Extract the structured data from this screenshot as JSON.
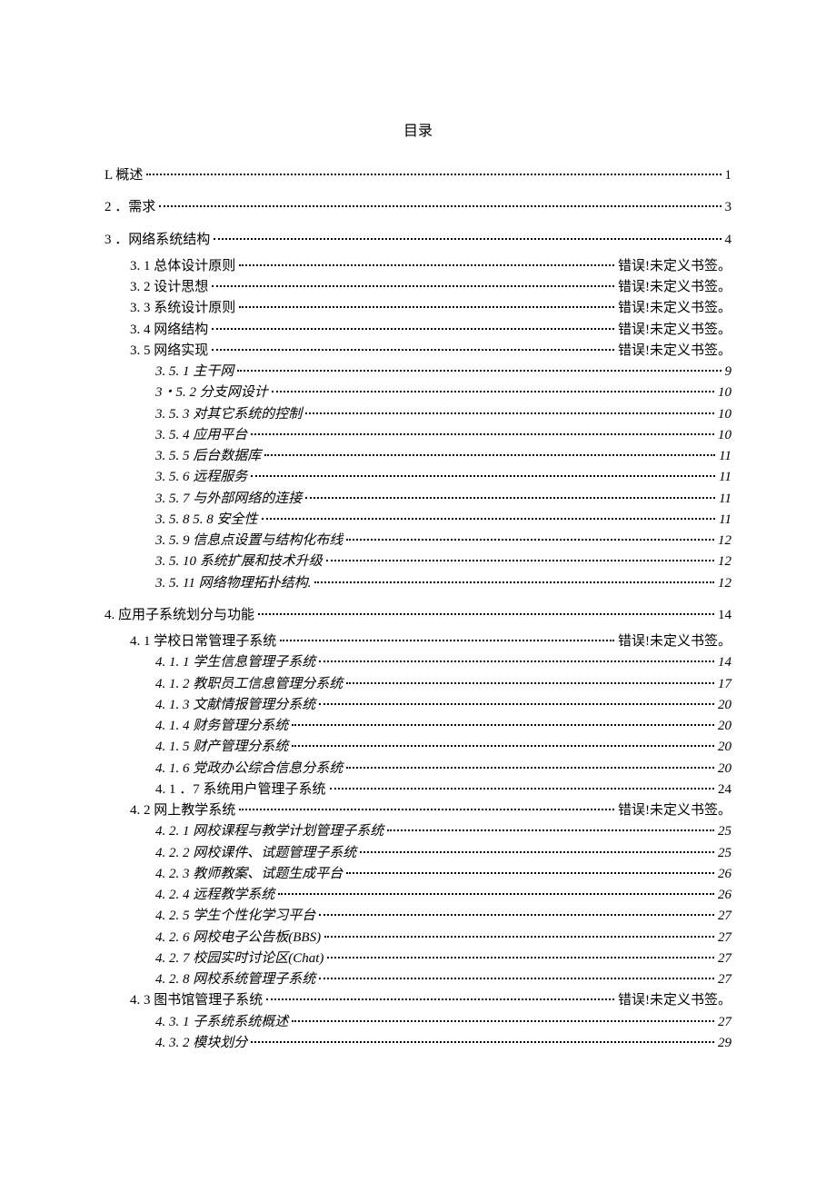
{
  "title": "目录",
  "bookmarkError": "错误!未定义书签。",
  "entries": [
    {
      "level": 1,
      "italic": false,
      "label": "L 概述",
      "page": "1"
    },
    {
      "level": 1,
      "italic": false,
      "label": "2 ．需求",
      "page": "3"
    },
    {
      "level": 1,
      "italic": false,
      "label": "3 ．网络系统结构",
      "page": "4"
    },
    {
      "level": 2,
      "italic": false,
      "label": "3. 1 总体设计原则",
      "page": "错误!未定义书签。"
    },
    {
      "level": 2,
      "italic": false,
      "label": "3. 2 设计思想",
      "page": "错误!未定义书签。"
    },
    {
      "level": 2,
      "italic": false,
      "label": "3. 3 系统设计原则",
      "page": "错误!未定义书签。"
    },
    {
      "level": 2,
      "italic": false,
      "label": "3. 4 网络结构",
      "page": "错误!未定义书签。"
    },
    {
      "level": 2,
      "italic": false,
      "label": "3. 5 网络实现",
      "page": "错误!未定义书签。"
    },
    {
      "level": 3,
      "italic": true,
      "label": "3. 5. 1 主干网",
      "page": "9"
    },
    {
      "level": 3,
      "italic": true,
      "label": "3・5. 2 分支网设计",
      "page": "10"
    },
    {
      "level": 3,
      "italic": true,
      "label": "3. 5. 3   对其它系统的控制",
      "page": "10"
    },
    {
      "level": 3,
      "italic": true,
      "label": "3. 5. 4   应用平台",
      "page": "10"
    },
    {
      "level": 3,
      "italic": true,
      "label": "3. 5. 5 后台数据库",
      "page": "11"
    },
    {
      "level": 3,
      "italic": true,
      "label": "3. 5. 6   远程服务",
      "page": "11"
    },
    {
      "level": 3,
      "italic": true,
      "label": "3. 5. 7   与外部网络的连接",
      "page": "11"
    },
    {
      "level": 3,
      "italic": true,
      "label": "3. 5. 8 5. 8 安全性",
      "page": "11"
    },
    {
      "level": 3,
      "italic": true,
      "label": "3. 5. 9 信息点设置与结构化布线",
      "page": "12"
    },
    {
      "level": 3,
      "italic": true,
      "label": "3. 5. 10 系统扩展和技术升级",
      "page": "12"
    },
    {
      "level": 3,
      "italic": true,
      "label": "3. 5. 11 网络物理拓扑结构.",
      "page": "12"
    },
    {
      "level": 1,
      "italic": false,
      "label": "4. 应用子系统划分与功能",
      "page": "14"
    },
    {
      "level": 2,
      "italic": false,
      "label": "4. 1  学校日常管理子系统",
      "page": "错误!未定义书签。"
    },
    {
      "level": 3,
      "italic": true,
      "label": "4. 1. 1   学生信息管理子系统",
      "page": "14"
    },
    {
      "level": 3,
      "italic": true,
      "label": "4. 1. 2   教职员工信息管理分系统",
      "page": "17"
    },
    {
      "level": 3,
      "italic": true,
      "label": "4. 1. 3 文献情报管理分系统",
      "page": "20"
    },
    {
      "level": 3,
      "italic": true,
      "label": "4. 1. 4 财务管理分系统",
      "page": "20"
    },
    {
      "level": 3,
      "italic": true,
      "label": "4. 1. 5 财产管理分系统",
      "page": "20"
    },
    {
      "level": 3,
      "italic": true,
      "label": "4. 1. 6         党政办公综合信息分系统",
      "page": "20"
    },
    {
      "level": 3,
      "italic": false,
      "label": "4. 1 ．7     系统用户管理子系统",
      "page": "24"
    },
    {
      "level": 2,
      "italic": false,
      "label": "4. 2  网上教学系统",
      "page": "错误!未定义书签。"
    },
    {
      "level": 3,
      "italic": true,
      "label": "4. 2. 1 网校课程与教学计划管理子系统",
      "page": "25"
    },
    {
      "level": 3,
      "italic": true,
      "label": "4. 2. 2 网校课件、试题管理子系统",
      "page": "25"
    },
    {
      "level": 3,
      "italic": true,
      "label": "4. 2. 3 教师教案、试题生成平台",
      "page": "26"
    },
    {
      "level": 3,
      "italic": true,
      "label": "4. 2. 4 远程教学系统",
      "page": "26"
    },
    {
      "level": 3,
      "italic": true,
      "label": "4. 2. 5 学生个性化学习平台",
      "page": "27"
    },
    {
      "level": 3,
      "italic": true,
      "label": "4. 2. 6 网校电子公告板(BBS)",
      "page": "27"
    },
    {
      "level": 3,
      "italic": true,
      "label": "4. 2. 7 校园实时讨论区(Chat)",
      "page": "27"
    },
    {
      "level": 3,
      "italic": true,
      "label": "4. 2. 8 网校系统管理子系统",
      "page": "27"
    },
    {
      "level": 2,
      "italic": false,
      "label": "4. 3 图书馆管理子系统",
      "page": "错误!未定义书签。"
    },
    {
      "level": 3,
      "italic": true,
      "label": "4. 3. 1 子系统系统概述",
      "page": "27"
    },
    {
      "level": 3,
      "italic": true,
      "label": "4. 3. 2 模块划分",
      "page": "29"
    }
  ]
}
